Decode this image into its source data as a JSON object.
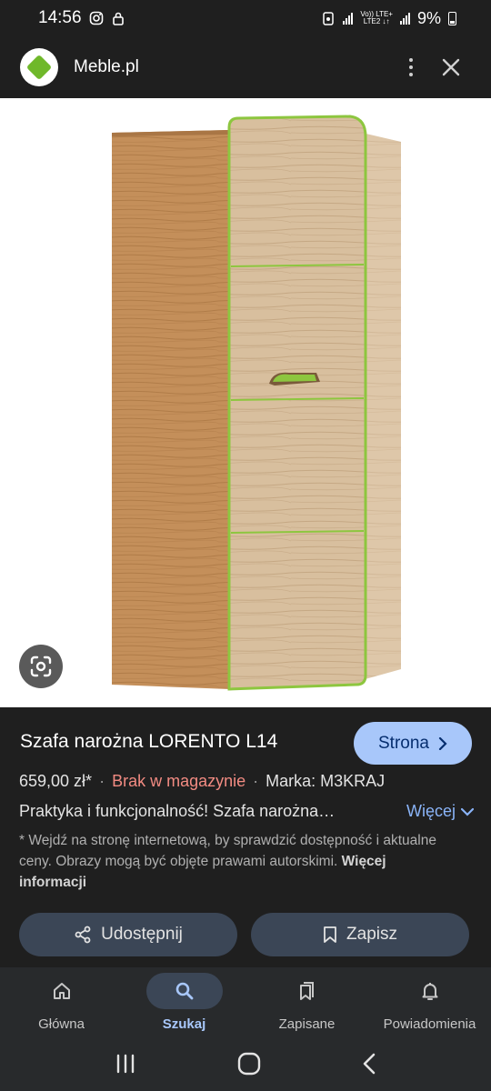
{
  "status": {
    "time": "14:56",
    "net_top": "Vo)) LTE+",
    "net_bottom": "LTE2 ↓↑",
    "battery": "9%"
  },
  "header": {
    "site_name": "Meble.pl",
    "logo_color": "#6fb82a"
  },
  "product": {
    "title": "Szafa narożna LORENTO L14",
    "site_button": "Strona",
    "price": "659,00 zł*",
    "stock": "Brak w magazynie",
    "brand": "Marka: M3KRAJ",
    "description": "Praktyka i funkcjonalność! Szafa narożna…",
    "more_label": "Więcej",
    "disclaimer": "* Wejdź na stronę internetową, by sprawdzić dostępność i aktualne ceny. Obrazy mogą być objęte prawami autorskimi.",
    "more_info": "Więcej informacji"
  },
  "actions": {
    "share": "Udostępnij",
    "save": "Zapisz"
  },
  "nav": [
    {
      "label": "Główna",
      "icon": "home-icon"
    },
    {
      "label": "Szukaj",
      "icon": "search-icon",
      "active": true
    },
    {
      "label": "Zapisane",
      "icon": "bookmarks-icon"
    },
    {
      "label": "Powiadomienia",
      "icon": "bell-icon"
    }
  ],
  "colors": {
    "accent": "#a8c7fa",
    "stock_status": "#f28b82",
    "link": "#8ab4f8"
  }
}
